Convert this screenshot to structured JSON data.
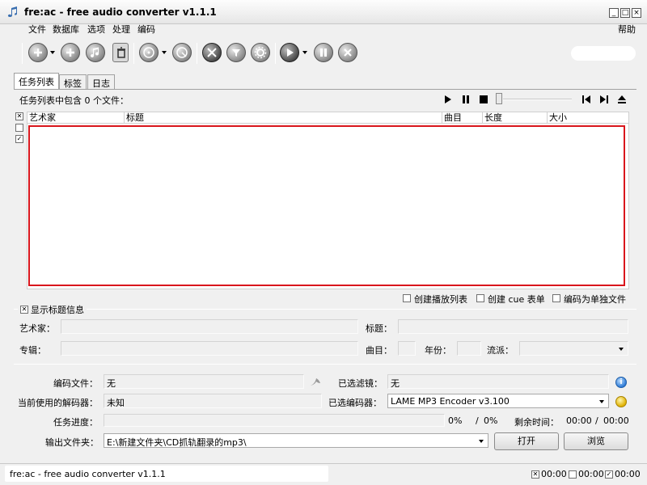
{
  "window": {
    "title": "fre:ac - free audio converter v1.1.1",
    "min": "_",
    "max": "□",
    "close": "×"
  },
  "menu": {
    "file": "文件",
    "database": "数据库",
    "options": "选项",
    "process": "处理",
    "encode": "编码",
    "help": "帮助"
  },
  "tabs": {
    "joblist": "任务列表",
    "tags": "标签",
    "log": "日志"
  },
  "joblist": {
    "summary": "任务列表中包含 0 个文件：",
    "columns": [
      "艺术家",
      "标题",
      "曲目",
      "长度",
      "大小"
    ]
  },
  "options": {
    "create_playlist": "创建播放列表",
    "create_cue": "创建 cue 表单",
    "encode_single": "编码为单独文件"
  },
  "title_info": {
    "toggle": "显示标题信息",
    "artist_label": "艺术家：",
    "title_label": "标题：",
    "album_label": "专辑：",
    "track_label": "曲目：",
    "year_label": "年份：",
    "genre_label": "流派："
  },
  "status": {
    "encoding_file_label": "编码文件：",
    "encoding_file_value": "无",
    "selected_filter_label": "已选滤镜：",
    "selected_filter_value": "无",
    "decoder_label": "当前使用的解码器：",
    "decoder_value": "未知",
    "encoder_label": "已选编码器：",
    "encoder_value": "LAME MP3 Encoder v3.100",
    "progress_label": "任务进度：",
    "progress_pct1": "0%",
    "progress_slash": "/",
    "progress_pct2": "0%",
    "remaining_label": "剩余时间：",
    "remaining_time1": "00:00",
    "remaining_slash": "/",
    "remaining_time2": "00:00",
    "output_label": "输出文件夹：",
    "output_value": "E:\\新建文件夹\\CD抓轨翻录的mp3\\",
    "open_button": "打开",
    "browse_button": "浏览"
  },
  "statusbar": {
    "text": "fre:ac - free audio converter v1.1.1",
    "t1": "00:00",
    "t2": "00:00",
    "t3": "00:00"
  },
  "colors": {
    "highlight_border": "#d9161c"
  }
}
